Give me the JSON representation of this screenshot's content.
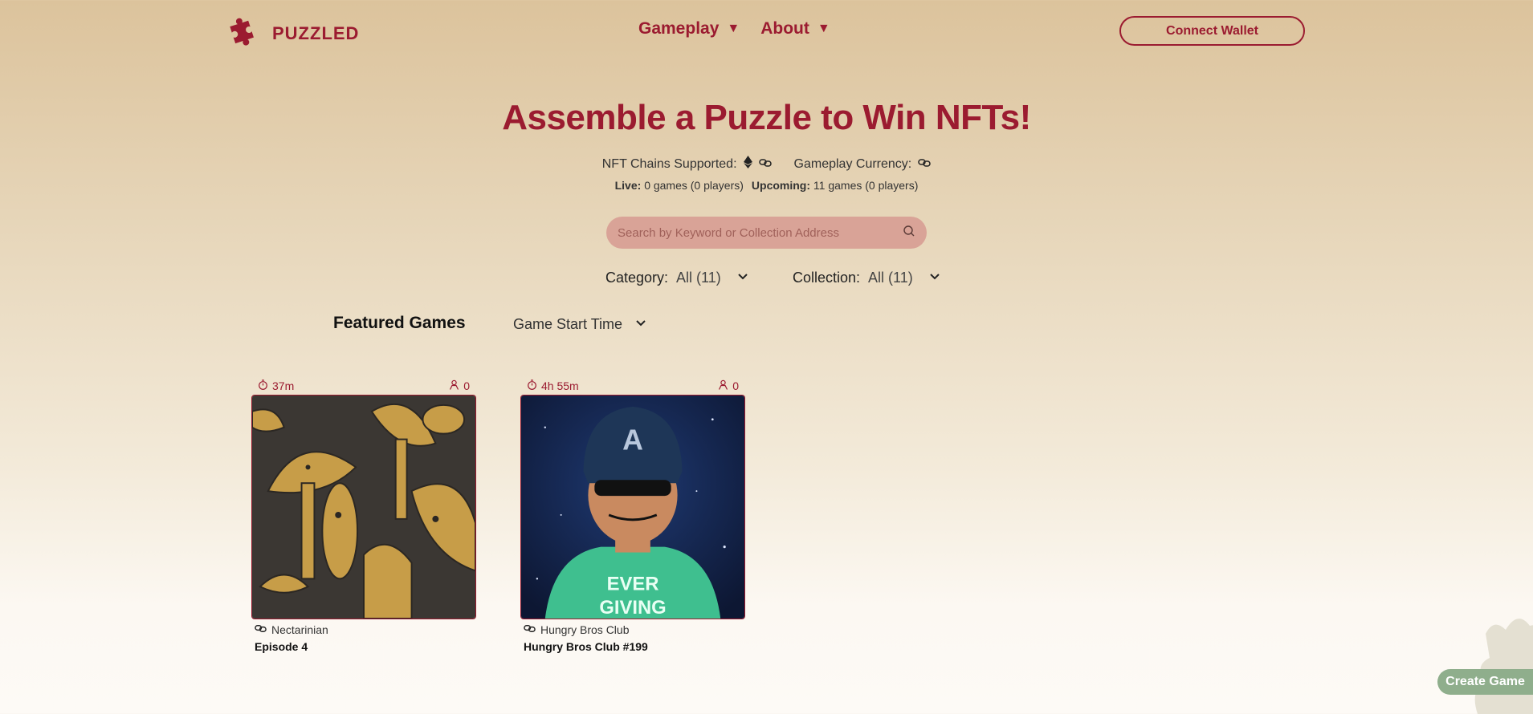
{
  "brand": {
    "name": "PUZZLED",
    "logo_icon": "puzzle-piece-icon",
    "accent": "#9b1b30"
  },
  "nav": [
    {
      "label": "Gameplay",
      "icon": "triangle-down-icon"
    },
    {
      "label": "About",
      "icon": "triangle-down-icon"
    }
  ],
  "header": {
    "connect_wallet": "Connect Wallet"
  },
  "hero": {
    "title": "Assemble a Puzzle to Win NFTs!",
    "chains_label": "NFT Chains Supported:",
    "chains_icons": [
      "ethereum-icon",
      "chainlink-icon"
    ],
    "currency_label": "Gameplay Currency:",
    "currency_icon": "chainlink-icon",
    "live_label": "Live:",
    "live_value": "0 games (0 players)",
    "upcoming_label": "Upcoming:",
    "upcoming_value": "11 games (0 players)"
  },
  "search": {
    "placeholder": "Search by Keyword or Collection Address",
    "icon": "search-icon",
    "bg": "#d9a397"
  },
  "filters": {
    "category_label": "Category:",
    "category_value": "All (11)",
    "collection_label": "Collection:",
    "collection_value": "All (11)"
  },
  "featured": {
    "title": "Featured Games",
    "sort_value": "Game Start Time"
  },
  "games": [
    {
      "time": "37m",
      "players": "0",
      "collection": "Nectarinian",
      "name": "Episode 4",
      "image": "mushroom-artwork"
    },
    {
      "time": "4h 55m",
      "players": "0",
      "collection": "Hungry Bros Club",
      "name": "Hungry Bros Club #199",
      "image": "helmet-character-artwork"
    }
  ],
  "create_game": {
    "label": "Create Game",
    "bg": "#8fae8c"
  }
}
